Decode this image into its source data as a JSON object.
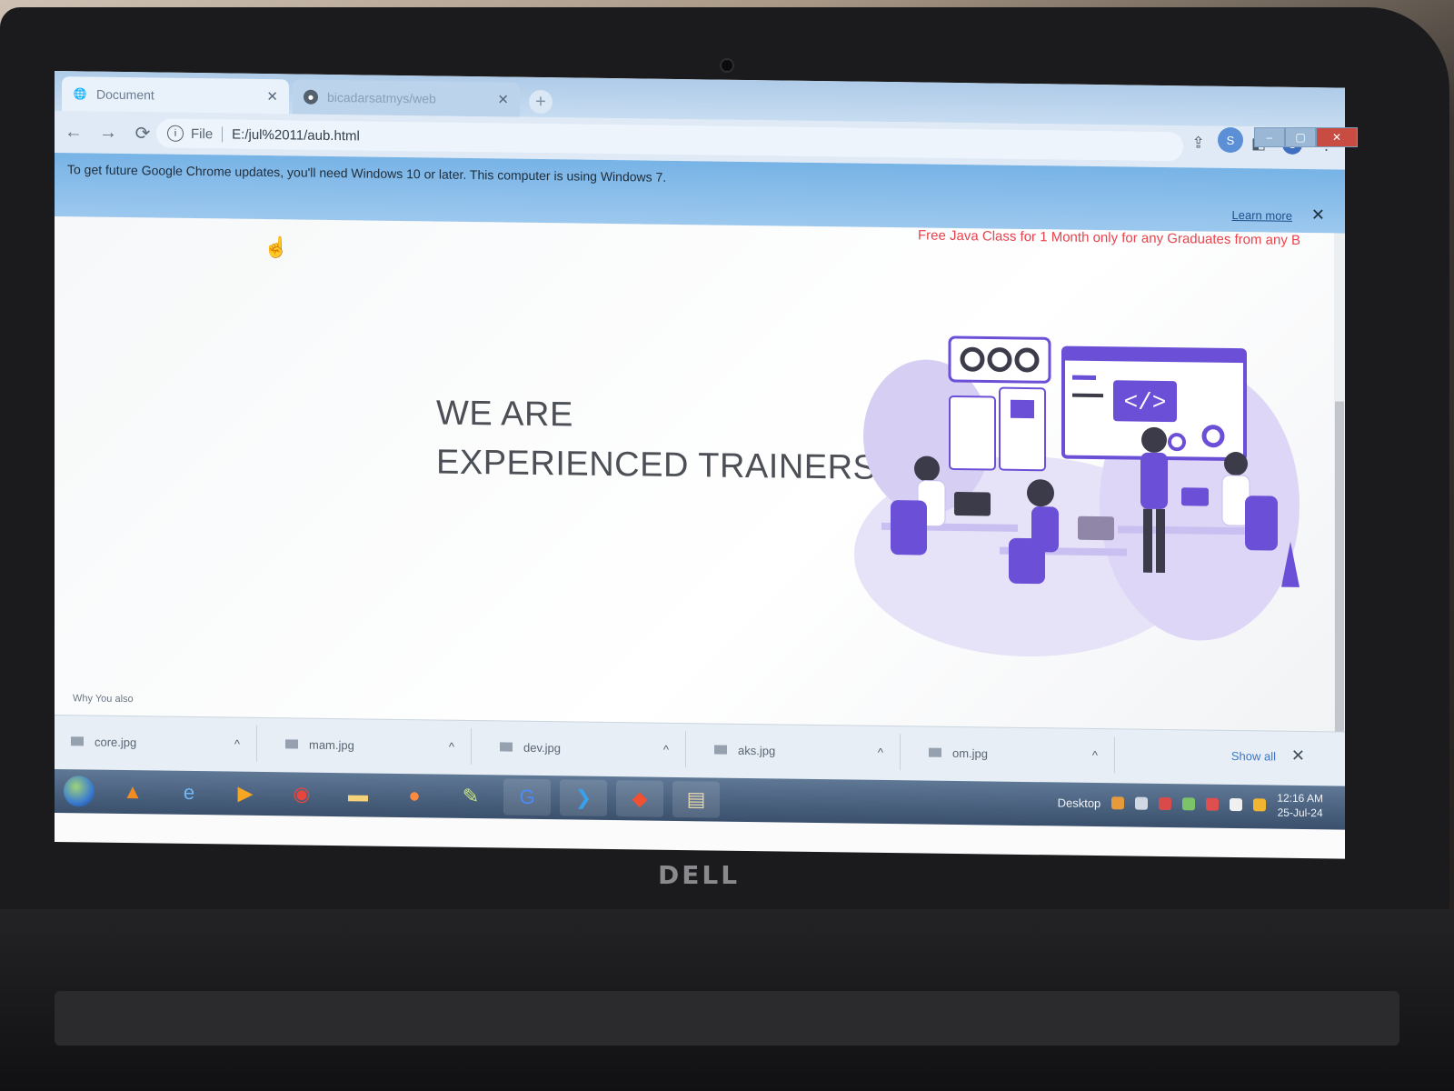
{
  "browser": {
    "tabs": [
      {
        "label": "Document",
        "icon": "globe-icon",
        "active": true
      },
      {
        "label": "bicadarsatmys/web",
        "icon": "github-icon",
        "active": false
      }
    ],
    "new_tab_symbol": "+",
    "window_controls": {
      "minimize": "–",
      "maximize": "▢",
      "close": "✕"
    },
    "profile_initial": "S",
    "address": {
      "scheme": "File",
      "url": "E:/jul%2011/aub.html"
    },
    "nav": {
      "back": "←",
      "forward": "→",
      "reload": "⟳",
      "info": "i"
    },
    "toolbar_icons": {
      "share": "⇪",
      "star": "☆",
      "sidepanel": "◧",
      "menu": "⋮"
    }
  },
  "infobar": {
    "message": "To get future Google Chrome updates, you'll need Windows 10 or later. This computer is using Windows 7.",
    "learn_more": "Learn more",
    "close": "✕"
  },
  "page": {
    "marquee": "Free Java Class for 1 Month only for any Graduates from any B",
    "headline_line1": "WE ARE",
    "headline_line2": "EXPERIENCED TRAINERS",
    "footer_peek": "Why You also",
    "hero_image": "team-coding-illustration"
  },
  "downloads": {
    "items": [
      {
        "name": "core.jpg"
      },
      {
        "name": "mam.jpg"
      },
      {
        "name": "dev.jpg"
      },
      {
        "name": "aks.jpg"
      },
      {
        "name": "om.jpg"
      }
    ],
    "caret": "^",
    "show_all": "Show all",
    "close": "✕"
  },
  "taskbar": {
    "apps": [
      "vlc-icon",
      "internet-explorer-icon",
      "media-player-icon",
      "chrome-icon",
      "folder-icon",
      "firefox-icon",
      "notepad-icon",
      "google-icon",
      "vscode-icon",
      "git-icon",
      "file-manager-icon"
    ],
    "desktop_label": "Desktop",
    "time": "12:16 AM",
    "date": "25-Jul-24"
  },
  "colors": {
    "accent_purple": "#6b4fd6",
    "light_purple": "#c9bff0",
    "marquee_red": "#e8434c",
    "infobar_blue": "#8bbdea"
  },
  "hardware": {
    "brand": "DELL"
  }
}
